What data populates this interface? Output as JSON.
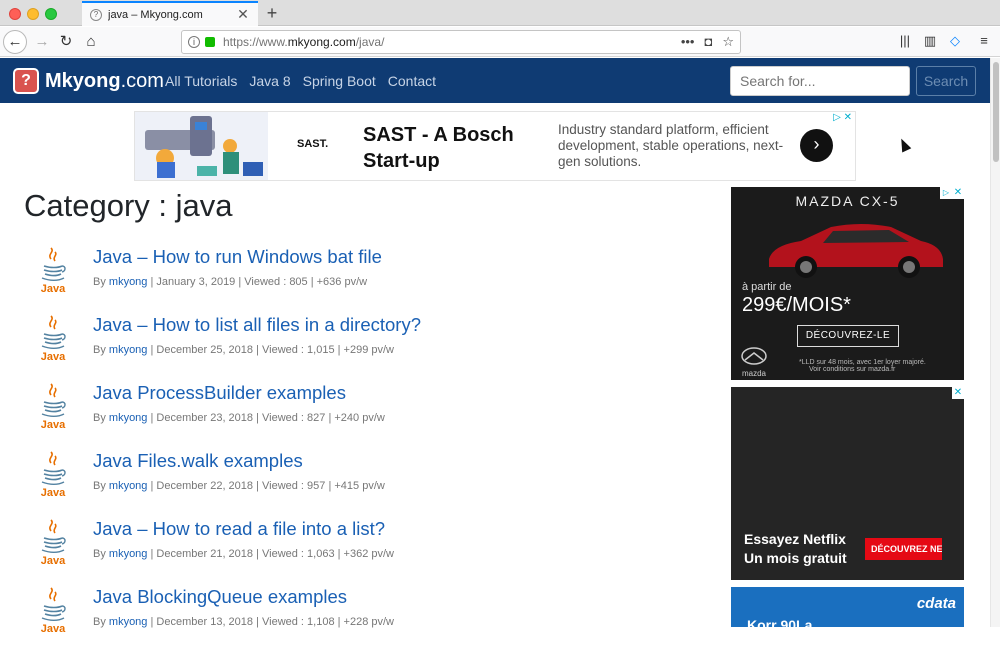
{
  "browser": {
    "tab_title": "java – Mkyong.com",
    "url_prefix": "https://www.",
    "url_domain": "mkyong.com",
    "url_path": "/java/",
    "more_icon": "•••"
  },
  "site": {
    "logo_main": "Mkyong",
    "logo_suffix": ".com",
    "logo_mark": "?",
    "menu": [
      "All Tutorials",
      "Java 8",
      "Spring Boot",
      "Contact"
    ],
    "search_placeholder": "Search for...",
    "search_button": "Search"
  },
  "top_ad": {
    "brand": "SAST.",
    "headline": "SAST - A Bosch Start-up",
    "body": "Industry standard platform, efficient development, stable operations, next-gen solutions."
  },
  "page_title": "Category : java",
  "java_logo_text": "Java",
  "posts": [
    {
      "title": "Java – How to run Windows bat file",
      "author": "mkyong",
      "meta": " | January 3, 2019 | Viewed : 805 | +636 pv/w"
    },
    {
      "title": "Java – How to list all files in a directory?",
      "author": "mkyong",
      "meta": " | December 25, 2018 | Viewed : 1,015 | +299 pv/w"
    },
    {
      "title": "Java ProcessBuilder examples",
      "author": "mkyong",
      "meta": " | December 23, 2018 | Viewed : 827 | +240 pv/w"
    },
    {
      "title": "Java Files.walk examples",
      "author": "mkyong",
      "meta": " | December 22, 2018 | Viewed : 957 | +415 pv/w"
    },
    {
      "title": "Java – How to read a file into a list?",
      "author": "mkyong",
      "meta": " | December 21, 2018 | Viewed : 1,063 | +362 pv/w"
    },
    {
      "title": "Java BlockingQueue examples",
      "author": "mkyong",
      "meta": " | December 13, 2018 | Viewed : 1,108 | +228 pv/w"
    }
  ],
  "by_label": "By ",
  "side_ads": {
    "mazda_title": "MAZDA CX-5",
    "mazda_apartir": "à partir de",
    "mazda_price": "299€/MOIS*",
    "mazda_cta": "DÉCOUVREZ-LE",
    "mazda_brand": "mazda",
    "mazda_legal_1": "*LLD sur 48 mois, avec 1er loyer majoré.",
    "mazda_legal_2": "Voir conditions sur mazda.fr",
    "netflix_line1": "Essayez Netflix",
    "netflix_line2": "Un mois gratuit",
    "netflix_cta": "DÉCOUVREZ NE",
    "cdata_logo": "cdata",
    "cdata_text": "Korr 90La"
  }
}
